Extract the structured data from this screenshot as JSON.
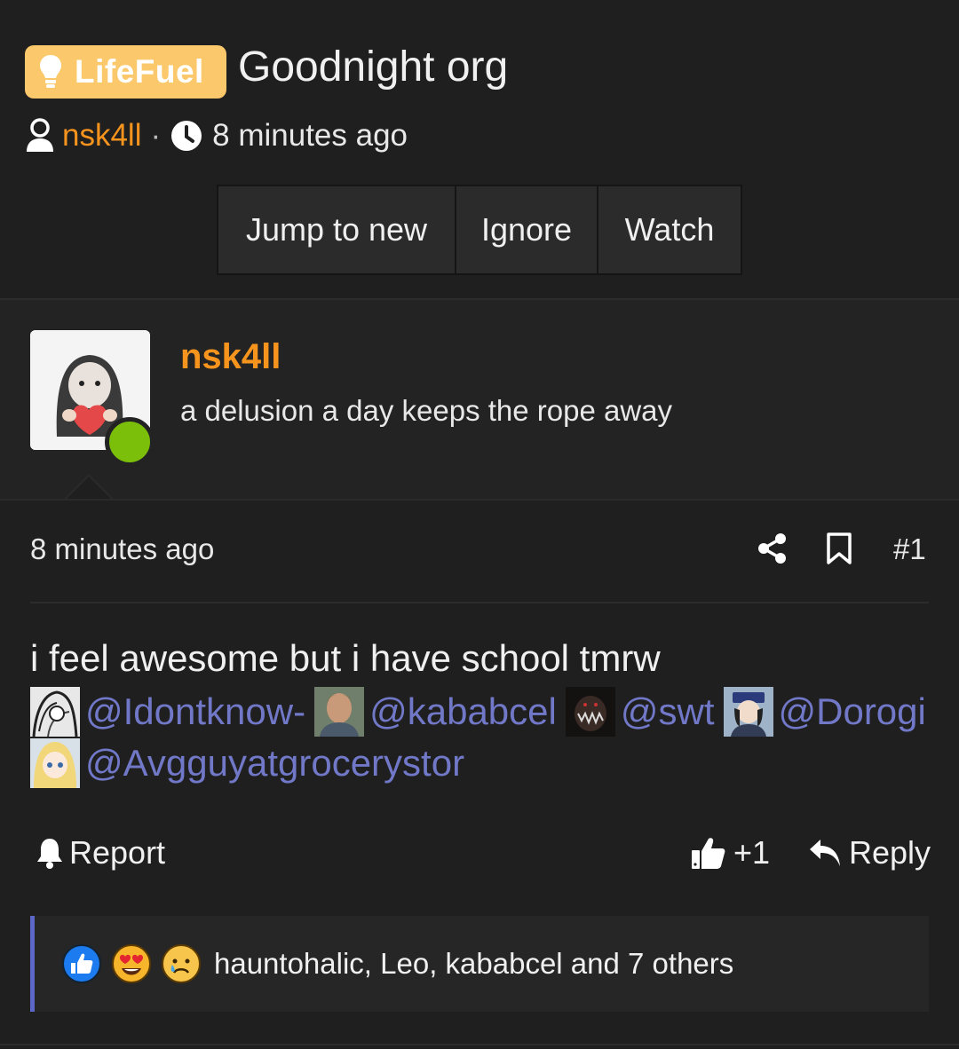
{
  "thread": {
    "prefix_label": "LifeFuel",
    "title": "Goodnight org",
    "author": "nsk4ll",
    "separator": "·",
    "time": "8 minutes ago"
  },
  "actions": {
    "jump_label": "Jump to new",
    "ignore_label": "Ignore",
    "watch_label": "Watch"
  },
  "post": {
    "username": "nsk4ll",
    "user_title": "a delusion a day keeps the rope away",
    "time": "8 minutes ago",
    "number": "#1",
    "body": "i feel awesome but i have school tmrw",
    "mentions": [
      {
        "name": "@Idontknow-"
      },
      {
        "name": "@kababcel"
      },
      {
        "name": "@swt"
      },
      {
        "name": "@Dorogi"
      },
      {
        "name": "@Avgguyatgrocerystor"
      }
    ],
    "report_label": "Report",
    "like_count": "+1",
    "reply_label": "Reply",
    "reactions_text": "hauntohalic, Leo, kababcel and 7 others"
  },
  "colors": {
    "accent_orange": "#f7941d",
    "badge_yellow": "#fbc86b",
    "mention_blue": "#7178c8",
    "online_green": "#7bbf0a",
    "reaction_bar": "#5c67c7"
  },
  "icons": [
    "lightbulb-icon",
    "user-icon",
    "clock-icon",
    "share-icon",
    "bookmark-icon",
    "bell-icon",
    "thumbs-up-icon",
    "reply-icon",
    "like-reaction-icon",
    "heart-eyes-reaction-icon",
    "sad-reaction-icon"
  ]
}
